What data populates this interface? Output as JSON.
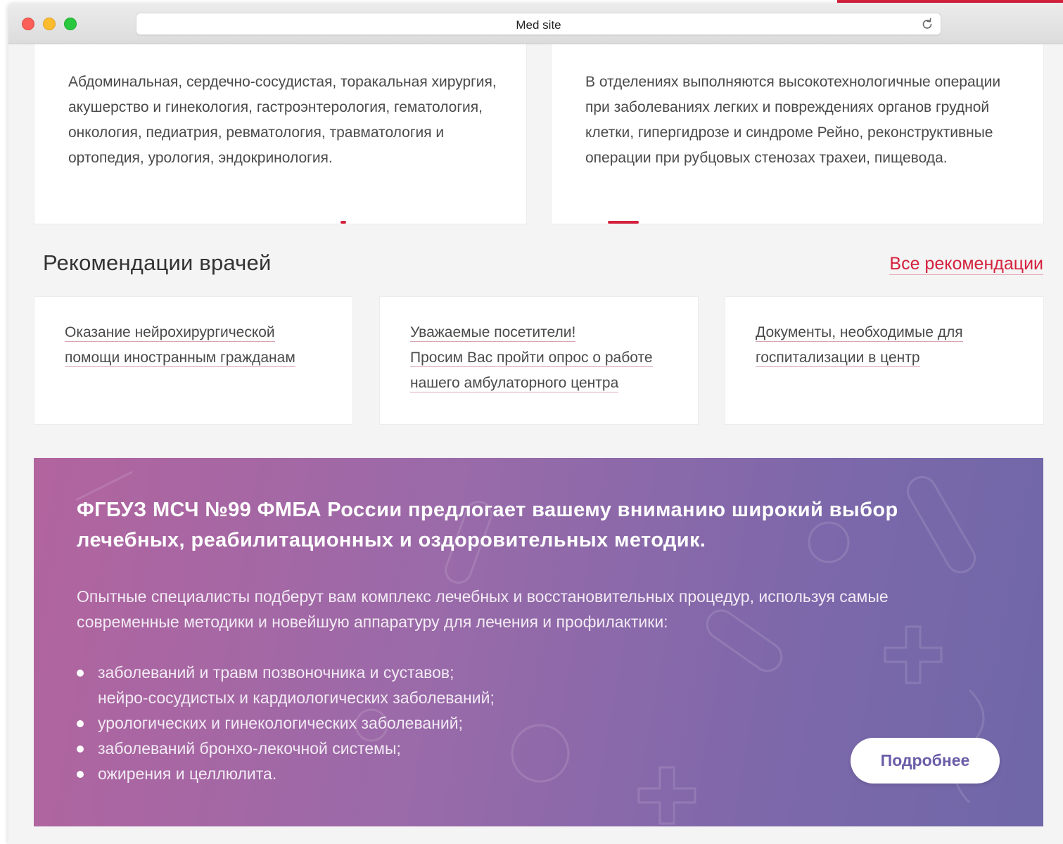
{
  "browser": {
    "address": "Med site"
  },
  "colors": {
    "accent": "#d4213d",
    "promo_start": "#b2649e",
    "promo_end": "#6f67a8",
    "button_text": "#6b5ca8"
  },
  "top_cards": [
    {
      "text": "Абдоминальная, сердечно-сосудистая, торакальная хирургия, акушерство и гинекология, гастроэнтерология, гематология, онкология, педиатрия, ревматология, травматология и ортопедия, урология, эндокринология."
    },
    {
      "text": "В отделениях выполняются высокотехнологичные операции при заболеваниях легких и повреждениях органов грудной клетки, гипергидрозе и синдроме Рейно, реконструктивные операции при рубцовых стенозах трахеи, пищевода."
    }
  ],
  "recommendations": {
    "title": "Рекомендации врачей",
    "all_link": "Все рекомендации",
    "items": [
      {
        "line1": "Оказание нейрохирургической",
        "line2": "помощи иностранным гражданам",
        "line3": ""
      },
      {
        "line1": "Уважаемые посетители!",
        "line2": "Просим Вас пройти опрос о работе",
        "line3": "нашего амбулаторного центра"
      },
      {
        "line1": "Документы, необходимые для",
        "line2": "госпитализации в центр",
        "line3": ""
      }
    ]
  },
  "promo": {
    "heading": "ФГБУЗ МСЧ №99 ФМБА России предлогает вашему вниманию широкий выбор лечебных, реабилитационных и оздоровительных методик.",
    "lead": "Опытные специалисты подберут вам комплекс лечебных и восстановительных процедур, используя самые современные методики и новейшую аппаратуру для лечения и профилактики:",
    "list": [
      {
        "line1": "заболеваний и травм позвоночника и суставов;",
        "line2": "нейро-сосудистых и кардиологических заболеваний;"
      },
      {
        "line1": "урологических и гинекологических заболеваний;",
        "line2": ""
      },
      {
        "line1": "заболеваний бронхо-лекочной системы;",
        "line2": ""
      },
      {
        "line1": "ожирения и целлюлита.",
        "line2": ""
      }
    ],
    "button": "Подробнее"
  },
  "icons": {
    "reload": "reload-icon",
    "bullet": "bullet-icon"
  }
}
